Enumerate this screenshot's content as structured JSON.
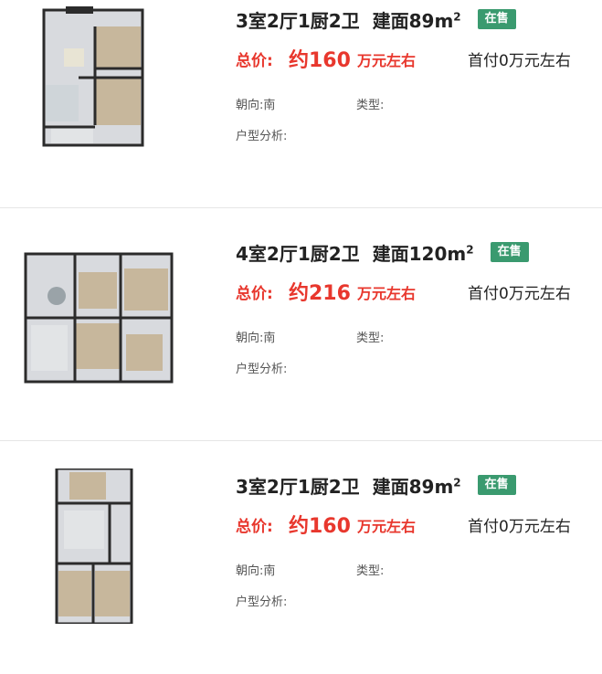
{
  "listings": [
    {
      "title": "3室2厅1厨2卫",
      "area_label": "建面89m",
      "area_sup": "2",
      "status": "在售",
      "price_label": "总价:",
      "price_value": "约160",
      "price_unit": "万元左右",
      "down_payment": "首付0万元左右",
      "orientation": "朝向:南",
      "type_label": "类型:",
      "analysis_label": "户型分析:"
    },
    {
      "title": "4室2厅1厨2卫",
      "area_label": "建面120m",
      "area_sup": "2",
      "status": "在售",
      "price_label": "总价:",
      "price_value": "约216",
      "price_unit": "万元左右",
      "down_payment": "首付0万元左右",
      "orientation": "朝向:南",
      "type_label": "类型:",
      "analysis_label": "户型分析:"
    },
    {
      "title": "3室2厅1厨2卫",
      "area_label": "建面89m",
      "area_sup": "2",
      "status": "在售",
      "price_label": "总价:",
      "price_value": "约160",
      "price_unit": "万元左右",
      "down_payment": "首付0万元左右",
      "orientation": "朝向:南",
      "type_label": "类型:",
      "analysis_label": "户型分析:"
    }
  ],
  "colors": {
    "price": "#e8372d",
    "badge": "#3a9a6f",
    "wall": "#2b2b2b",
    "floor": "#d8dade",
    "wood": "#c7b79c"
  }
}
